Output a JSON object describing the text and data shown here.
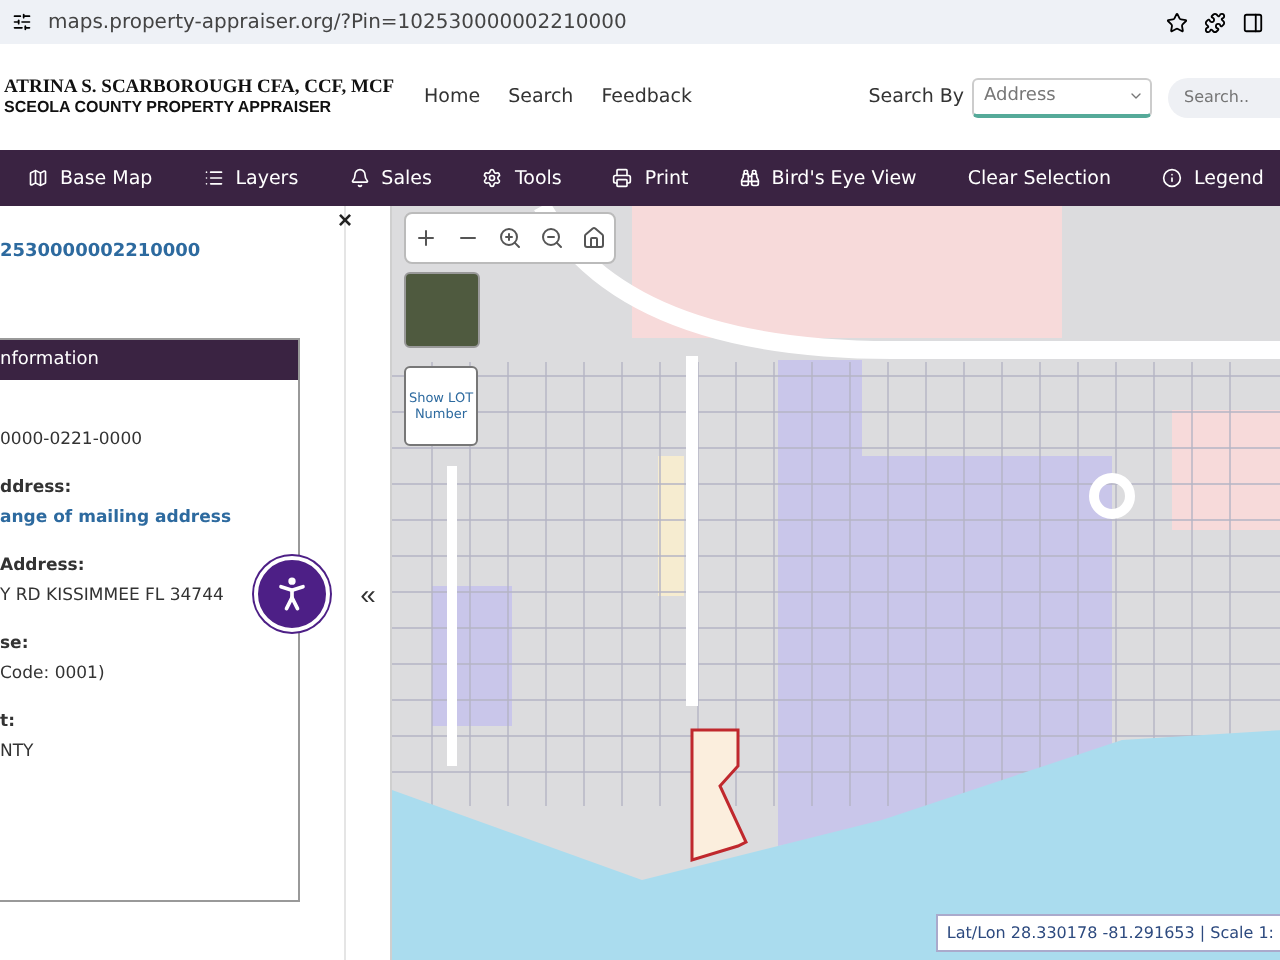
{
  "browser": {
    "url": "maps.property-appraiser.org/?Pin=102530000002210000"
  },
  "header": {
    "title": "ATRINA S. SCARBOROUGH CFA, CCF, MCF",
    "subtitle": "SCEOLA COUNTY PROPERTY APPRAISER",
    "links": [
      "Home",
      "Search",
      "Feedback"
    ],
    "search_by_label": "Search By",
    "search_by_value": "Address",
    "search": {
      "placeholder": "Search.."
    }
  },
  "toolbar": [
    {
      "kind": "map",
      "label": "Base Map"
    },
    {
      "kind": "list",
      "label": "Layers"
    },
    {
      "kind": "bell",
      "label": "Sales"
    },
    {
      "kind": "gear",
      "label": "Tools"
    },
    {
      "kind": "printer",
      "label": "Print"
    },
    {
      "kind": "binoculars",
      "label": "Bird's Eye View"
    },
    {
      "kind": "none",
      "label": "Clear Selection"
    },
    {
      "kind": "info",
      "label": "Legend"
    }
  ],
  "panel": {
    "pin": "2530000002210000",
    "close": "×",
    "collapse": "«",
    "section_title": "nformation",
    "lines": [
      {
        "kind": "value",
        "text": "0000-0221-0000"
      },
      {
        "kind": "label",
        "text": "ddress:"
      },
      {
        "kind": "link",
        "text": "ange of mailing address"
      },
      {
        "kind": "label",
        "text": "Address:"
      },
      {
        "kind": "value",
        "text": "Y RD KISSIMMEE FL 34744"
      },
      {
        "kind": "label",
        "text": "se:"
      },
      {
        "kind": "value",
        "text": "Code: 0001)"
      },
      {
        "kind": "label",
        "text": "t:"
      },
      {
        "kind": "value",
        "text": "NTY"
      }
    ]
  },
  "map": {
    "lot_button": "Show LOT Number",
    "coordinates": "Lat/Lon 28.330178 -81.291653 | Scale 1:"
  }
}
